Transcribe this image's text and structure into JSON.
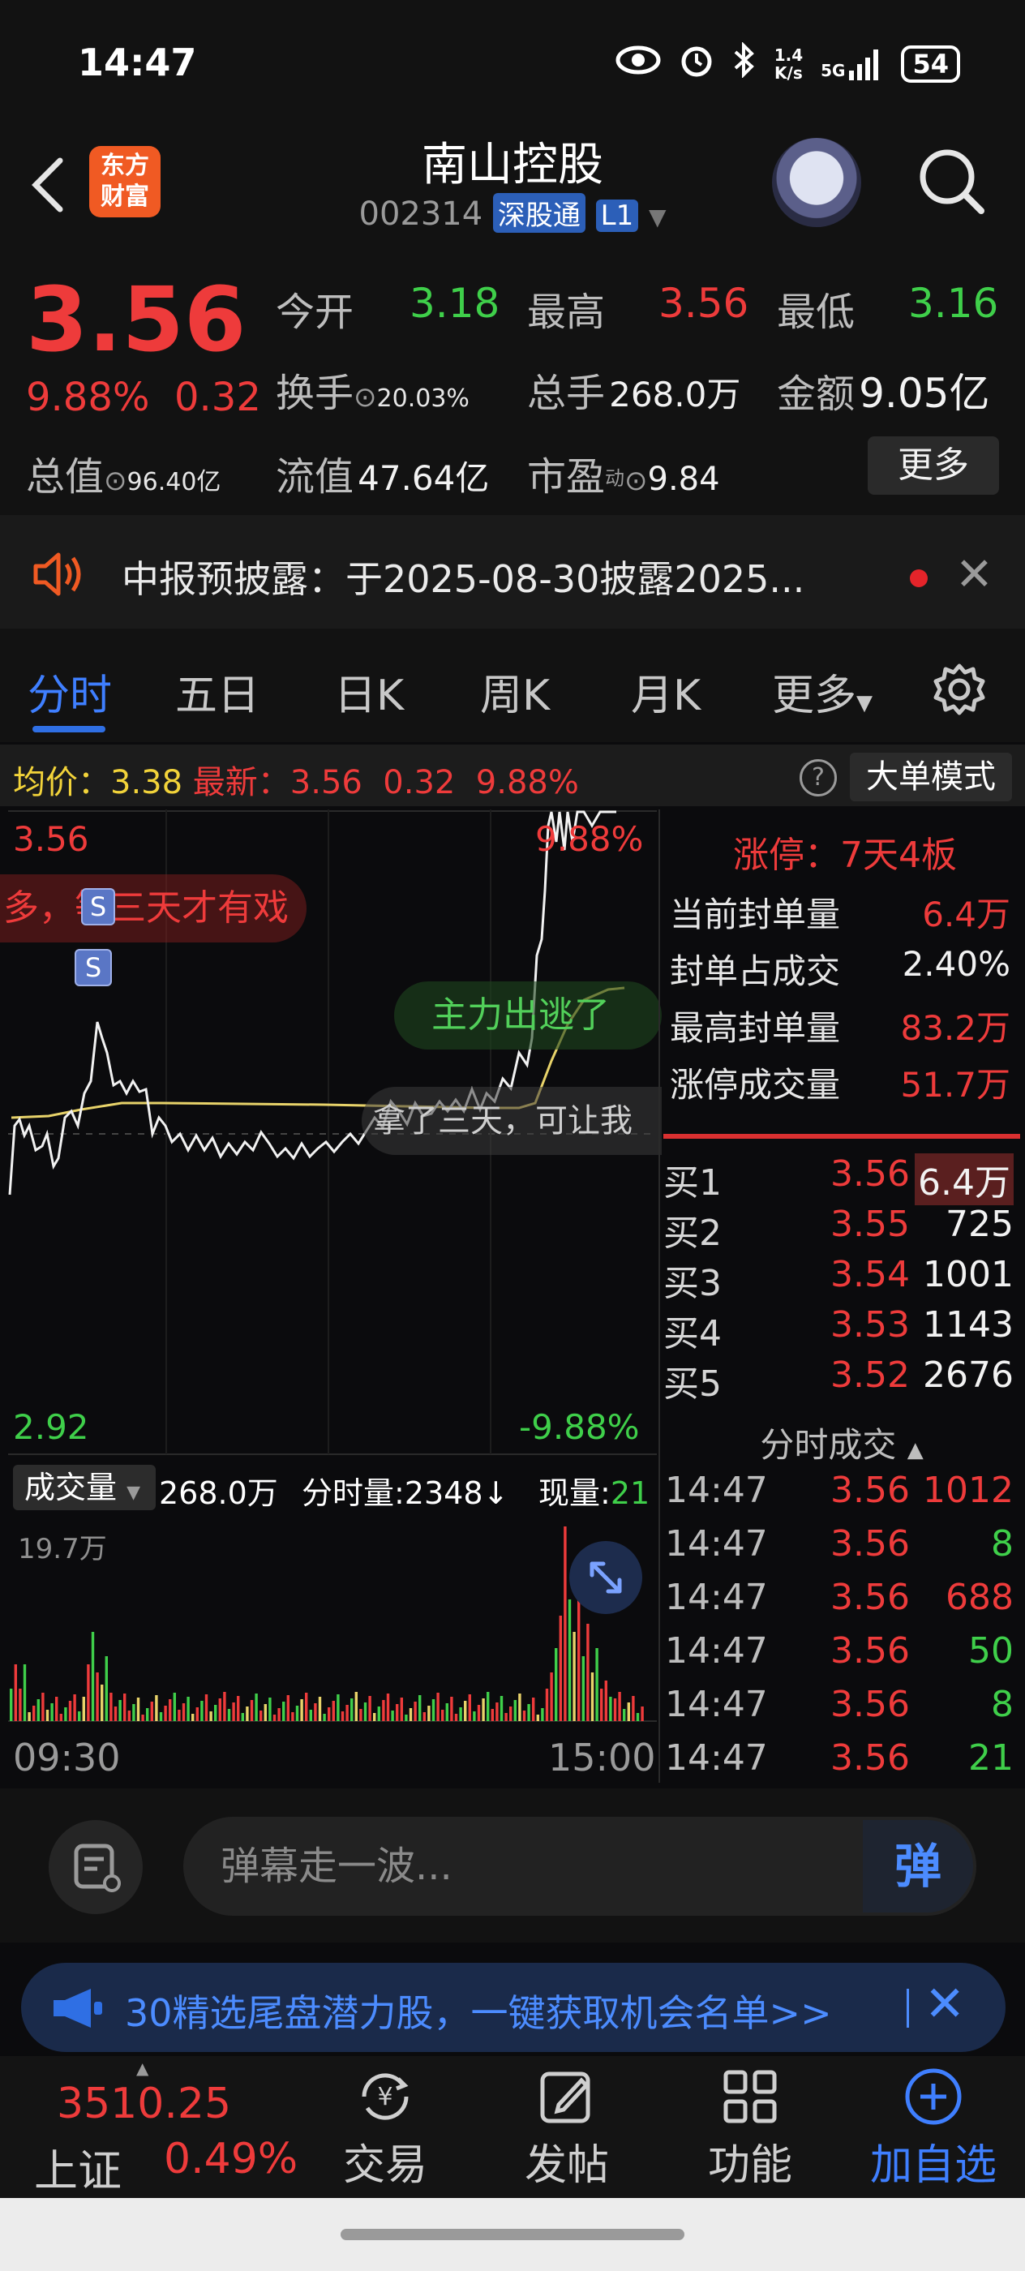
{
  "status_bar": {
    "time": "14:47",
    "net_speed_top": "1.4",
    "net_speed_bottom": "K/s",
    "signal": "5G",
    "battery": "54"
  },
  "header": {
    "logo_top": "东方",
    "logo_bottom": "财富",
    "stock_name": "南山控股",
    "stock_code": "002314",
    "connect_tag": "深股通",
    "level_tag": "L1"
  },
  "quote": {
    "last_price": "3.56",
    "change_pct": "9.88%",
    "change_amt": "0.32",
    "total_mv_label": "总值",
    "total_mv_value": "96.40亿",
    "open_label": "今开",
    "open_value": "3.18",
    "high_label": "最高",
    "high_value": "3.56",
    "low_label": "最低",
    "low_value": "3.16",
    "turnover_label": "换手",
    "turnover_value": "20.03%",
    "volume_label": "总手",
    "volume_value": "268.0万",
    "amount_label": "金额",
    "amount_value": "9.05亿",
    "float_mv_label": "流值",
    "float_mv_value": "47.64亿",
    "pe_label": "市盈",
    "pe_sup": "动",
    "pe_value": "9.84",
    "more_button": "更多"
  },
  "notice": {
    "text": "中报预披露：于2025-08-30披露2025..."
  },
  "tabs": [
    {
      "label": "分时"
    },
    {
      "label": "五日"
    },
    {
      "label": "日K"
    },
    {
      "label": "周K"
    },
    {
      "label": "月K"
    },
    {
      "label": "更多"
    }
  ],
  "chart_header": {
    "avg_label": "均价：",
    "avg_value": "3.38",
    "latest_label": "最新：",
    "latest_value": "3.56",
    "latest_change": "0.32",
    "latest_pct": "9.88%",
    "help": "?",
    "big_order_mode": "大单模式"
  },
  "chart_labels": {
    "price_top": "3.56",
    "pct_top": "9.88%",
    "price_bottom": "2.92",
    "pct_bottom": "-9.88%"
  },
  "danmaku": {
    "d1": "多，等三天才有戏",
    "d2": "主力出逃了",
    "d3": "拿了三天，可让我"
  },
  "markers": {
    "s1": "S",
    "s2": "S"
  },
  "volume": {
    "selector": "成交量",
    "total": "268.0万",
    "tick_label": "分时量:2348↓",
    "now_label": "现量:",
    "now_value": "21",
    "max_label": "19.7万",
    "time_start": "09:30",
    "time_end": "15:00"
  },
  "limit_panel": {
    "title": "涨停：7天4板",
    "rows": [
      {
        "label": "当前封单量",
        "value": "6.4万"
      },
      {
        "label": "封单占成交",
        "value": "2.40%"
      },
      {
        "label": "最高封单量",
        "value": "83.2万"
      },
      {
        "label": "涨停成交量",
        "value": "51.7万"
      }
    ]
  },
  "order_book": [
    {
      "label": "买1",
      "price": "3.56",
      "qty": "6.4万"
    },
    {
      "label": "买2",
      "price": "3.55",
      "qty": "725"
    },
    {
      "label": "买3",
      "price": "3.54",
      "qty": "1001"
    },
    {
      "label": "买4",
      "price": "3.53",
      "qty": "1143"
    },
    {
      "label": "买5",
      "price": "3.52",
      "qty": "2676"
    }
  ],
  "trades": {
    "title": "分时成交",
    "rows": [
      {
        "time": "14:47",
        "price": "3.56",
        "qty": "1012",
        "side": "buy"
      },
      {
        "time": "14:47",
        "price": "3.56",
        "qty": "8",
        "side": "sell"
      },
      {
        "time": "14:47",
        "price": "3.56",
        "qty": "688",
        "side": "buy"
      },
      {
        "time": "14:47",
        "price": "3.56",
        "qty": "50",
        "side": "sell"
      },
      {
        "time": "14:47",
        "price": "3.56",
        "qty": "8",
        "side": "sell"
      },
      {
        "time": "14:47",
        "price": "3.56",
        "qty": "21",
        "side": "sell"
      }
    ]
  },
  "comment": {
    "placeholder": "弹幕走一波...",
    "danmaku_button": "弹"
  },
  "promo": {
    "text": "30精选尾盘潜力股，一键获取机会名单>>"
  },
  "bottom_nav": {
    "index_value": "3510.25",
    "index_name": "上证",
    "index_pct": "0.49%",
    "items": [
      {
        "label": "交易",
        "icon": "yen-exchange-icon"
      },
      {
        "label": "发帖",
        "icon": "edit-post-icon"
      },
      {
        "label": "功能",
        "icon": "grid-apps-icon"
      },
      {
        "label": "加自选",
        "icon": "plus-circle-icon"
      }
    ]
  },
  "colors": {
    "up": "#ee3b3b",
    "down": "#3fcf4a",
    "accent": "#2f6fe4",
    "avg_line": "#e8d36a"
  }
}
